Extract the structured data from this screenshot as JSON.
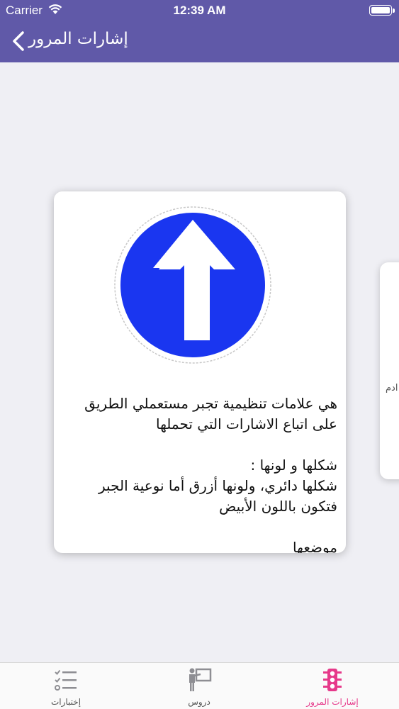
{
  "status_bar": {
    "carrier": "Carrier",
    "time": "12:39 AM"
  },
  "nav": {
    "title": "إشارات المرور"
  },
  "card": {
    "paragraph1": "هي علامات تنظيمية تجبر مستعملي الطريق\nعلى اتباع الاشارات التي تحملها",
    "paragraph2": "شكلها و لونها :\nشكلها دائري، ولونها أزرق أما نوعية الجبر\nفتكون باللون الأبيض",
    "paragraph3": "موضعها"
  },
  "peek_card": {
    "text": "ادم"
  },
  "tabs": [
    {
      "label": "إشارات المرور",
      "icon": "traffic-light-icon",
      "active": true
    },
    {
      "label": "دروس",
      "icon": "teacher-board-icon",
      "active": false
    },
    {
      "label": "إختبارات",
      "icon": "checklist-icon",
      "active": false
    }
  ],
  "colors": {
    "accent": "#6059a8",
    "active_tab": "#e6398a",
    "inactive_tab": "#8e8e93",
    "sign_blue": "#1a36f0"
  }
}
